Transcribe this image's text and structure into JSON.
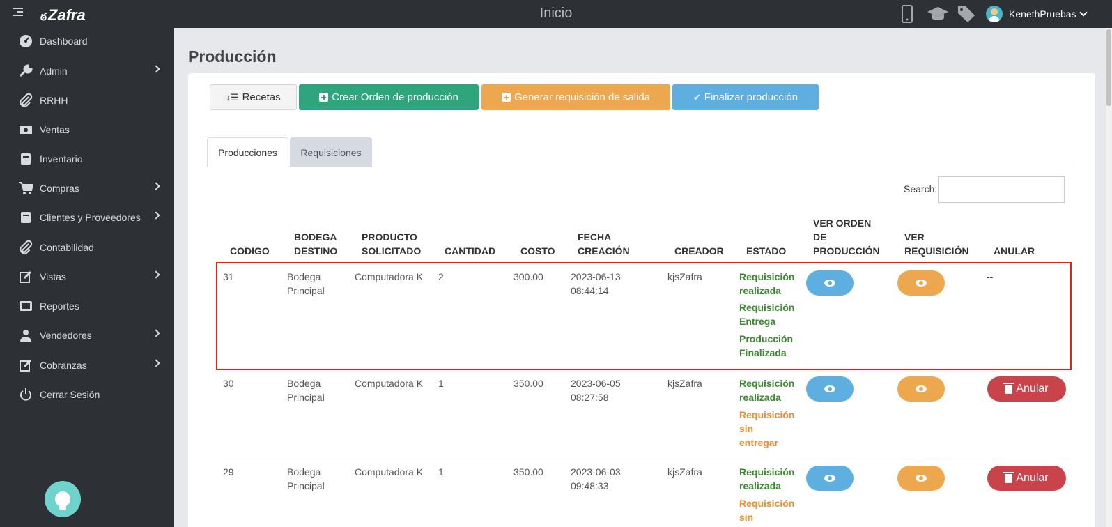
{
  "app": {
    "logo_glyph": "ఠ",
    "name": "Zafra",
    "page_header": "Inicio"
  },
  "topbar": {
    "user_name": "KenethPruebas",
    "icons": [
      "mobile-icon",
      "graduation-cap-icon",
      "tags-icon"
    ]
  },
  "sidebar": {
    "items": [
      {
        "label": "Dashboard",
        "icon": "dashboard-icon"
      },
      {
        "label": "Admin",
        "icon": "wrench-icon",
        "submenu": true
      },
      {
        "label": "RRHH",
        "icon": "paperclip-icon"
      },
      {
        "label": "Ventas",
        "icon": "money-icon"
      },
      {
        "label": "Inventario",
        "icon": "book-icon"
      },
      {
        "label": "Compras",
        "icon": "cart-icon",
        "submenu": true
      },
      {
        "label": "Clientes y Proveedores",
        "icon": "book-icon",
        "submenu": true
      },
      {
        "label": "Contabilidad",
        "icon": "paperclip-icon"
      },
      {
        "label": "Vistas",
        "icon": "edit-icon",
        "submenu": true
      },
      {
        "label": "Reportes",
        "icon": "list-icon"
      },
      {
        "label": "Vendedores",
        "icon": "user-icon",
        "submenu": true
      },
      {
        "label": "Cobranzas",
        "icon": "edit-icon",
        "submenu": true
      },
      {
        "label": "Cerrar Sesión",
        "icon": "power-icon"
      }
    ]
  },
  "main": {
    "title": "Producción",
    "buttons": {
      "recetas": "Recetas",
      "crear_orden": "Crear Orden de producción",
      "generar_requisicion": "Generar requisición de salida",
      "finalizar": "Finalizar producción"
    },
    "tabs": [
      {
        "label": "Producciones",
        "active": true
      },
      {
        "label": "Requisiciones",
        "active": false
      }
    ],
    "search": {
      "label": "Search:",
      "value": ""
    },
    "table": {
      "headers": {
        "codigo": "CODIGO",
        "bodega_1": "BODEGA",
        "bodega_2": "DESTINO",
        "producto_1": "PRODUCTO",
        "producto_2": "SOLICITADO",
        "cantidad": "CANTIDAD",
        "costo": "COSTO",
        "fecha_1": "FECHA",
        "fecha_2": "CREACIÓN",
        "creador": "CREADOR",
        "estado": "ESTADO",
        "ver_orden_1": "VER ORDEN",
        "ver_orden_2": "DE",
        "ver_orden_3": "PRODUCCIÓN",
        "ver_req_1": "VER",
        "ver_req_2": "REQUISICIÓN",
        "anular": "ANULAR"
      },
      "rows": [
        {
          "codigo": "31",
          "bodega_1": "Bodega",
          "bodega_2": "Principal",
          "producto": "Computadora K",
          "cantidad": "2",
          "costo": "300.00",
          "fecha_1": "2023-06-13",
          "fecha_2": "08:44:14",
          "creador": "kjsZafra",
          "estado": [
            {
              "l1": "Requisición",
              "l2": "realizada",
              "color": "#3a8a2e"
            },
            {
              "l1": "Requisición",
              "l2": "Entrega",
              "color": "#3a8a2e"
            },
            {
              "l1": "Producción",
              "l2": "Finalizada",
              "color": "#3a8a2e"
            }
          ],
          "anular": "--"
        },
        {
          "codigo": "30",
          "bodega_1": "Bodega",
          "bodega_2": "Principal",
          "producto": "Computadora K",
          "cantidad": "1",
          "costo": "350.00",
          "fecha_1": "2023-06-05",
          "fecha_2": "08:27:58",
          "creador": "kjsZafra",
          "estado": [
            {
              "l1": "Requisición",
              "l2": "realizada",
              "color": "#3a8a2e"
            },
            {
              "l1": "Requisición",
              "l2": "sin",
              "l3": "entregar",
              "color": "#ee8a2a"
            }
          ],
          "anular": "Anular"
        },
        {
          "codigo": "29",
          "bodega_1": "Bodega",
          "bodega_2": "Principal",
          "producto": "Computadora K",
          "cantidad": "1",
          "costo": "350.00",
          "fecha_1": "2023-06-03",
          "fecha_2": "09:48:33",
          "creador": "kjsZafra",
          "estado": [
            {
              "l1": "Requisición",
              "l2": "realizada",
              "color": "#3a8a2e"
            },
            {
              "l1": "Requisición",
              "l2": "sin",
              "color": "#ee8a2a"
            }
          ],
          "anular": "Anular"
        }
      ]
    }
  },
  "colors": {
    "sidebar_bg": "#2d3035",
    "green": "#2ea57c",
    "orange": "#eda84f",
    "blue": "#5eaee0",
    "red": "#c9434a",
    "highlight": "#e2231a"
  }
}
